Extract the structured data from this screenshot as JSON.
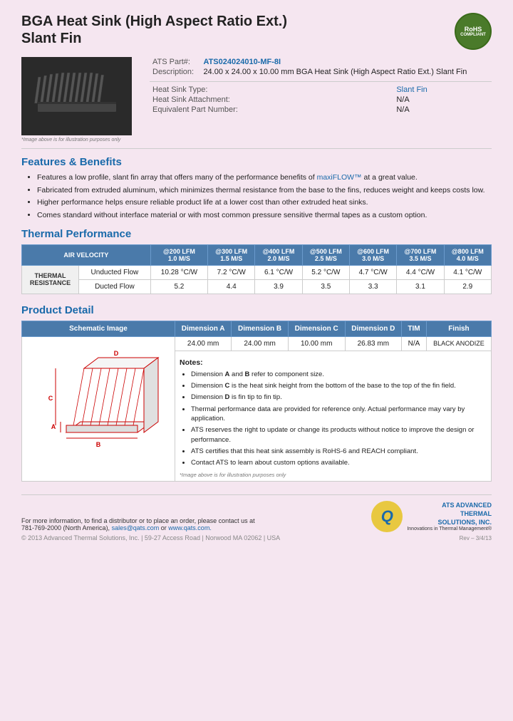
{
  "page": {
    "title_line1": "BGA Heat Sink (High Aspect Ratio Ext.)",
    "title_line2": "Slant Fin",
    "rohs": {
      "line1": "RoHS",
      "line2": "COMPLIANT"
    },
    "part_label": "ATS Part#:",
    "part_number": "ATS024024010-MF-8I",
    "description_label": "Description:",
    "description": "24.00 x 24.00 x 10.00 mm BGA Heat Sink (High Aspect Ratio Ext.) Slant Fin",
    "heat_sink_type_label": "Heat Sink Type:",
    "heat_sink_type": "Slant Fin",
    "heat_sink_attachment_label": "Heat Sink Attachment:",
    "heat_sink_attachment": "N/A",
    "equivalent_part_label": "Equivalent Part Number:",
    "equivalent_part": "N/A",
    "image_note": "*Image above is for illustration purposes only",
    "features_heading": "Features & Benefits",
    "features": [
      "Features a low profile, slant fin array that offers many of the performance benefits of maxiFLOW™ at a great value.",
      "Fabricated from extruded aluminum, which minimizes thermal resistance from the base to the fins, reduces weight and keeps costs low.",
      "Higher performance helps ensure reliable product life at a lower cost than other extruded heat sinks.",
      "Comes standard without interface material or with most common pressure sensitive thermal tapes as a custom option."
    ],
    "thermal_heading": "Thermal Performance",
    "thermal_table": {
      "header_col1": "AIR VELOCITY",
      "columns": [
        {
          "lfm": "@200 LFM",
          "ms": "1.0 M/S"
        },
        {
          "lfm": "@300 LFM",
          "ms": "1.5 M/S"
        },
        {
          "lfm": "@400 LFM",
          "ms": "2.0 M/S"
        },
        {
          "lfm": "@500 LFM",
          "ms": "2.5 M/S"
        },
        {
          "lfm": "@600 LFM",
          "ms": "3.0 M/S"
        },
        {
          "lfm": "@700 LFM",
          "ms": "3.5 M/S"
        },
        {
          "lfm": "@800 LFM",
          "ms": "4.0 M/S"
        }
      ],
      "row_label": "THERMAL RESISTANCE",
      "rows": [
        {
          "type": "Unducted Flow",
          "values": [
            "10.28 °C/W",
            "7.2 °C/W",
            "6.1 °C/W",
            "5.2 °C/W",
            "4.7 °C/W",
            "4.4 °C/W",
            "4.1 °C/W"
          ]
        },
        {
          "type": "Ducted Flow",
          "values": [
            "5.2",
            "4.4",
            "3.9",
            "3.5",
            "3.3",
            "3.1",
            "2.9"
          ]
        }
      ]
    },
    "product_detail_heading": "Product Detail",
    "detail_table": {
      "headers": [
        "Schematic Image",
        "Dimension A",
        "Dimension B",
        "Dimension C",
        "Dimension D",
        "TIM",
        "Finish"
      ],
      "values": [
        "24.00 mm",
        "24.00 mm",
        "10.00 mm",
        "26.83 mm",
        "N/A",
        "BLACK ANODIZE"
      ]
    },
    "notes_heading": "Notes:",
    "notes": [
      "Dimension A and B refer to component size.",
      "Dimension C is the heat sink height from the bottom of the base to the top of the fin field.",
      "Dimension D is fin tip to fin tip.",
      "Thermal performance data are provided for reference only. Actual performance may vary by application.",
      "ATS reserves the right to update or change its products without notice to improve the design or performance.",
      "ATS certifies that this heat sink assembly is RoHS-6 and REACH compliant.",
      "Contact ATS to learn about custom options available."
    ],
    "schematic_note": "*Image above is for illustration purposes only",
    "footer": {
      "contact_text": "For more information, to find a distributor or to place an order, please contact us at",
      "phone": "781-769-2000 (North America),",
      "email": "sales@qats.com",
      "or": "or",
      "website": "www.qats.com.",
      "copyright": "© 2013 Advanced Thermal Solutions, Inc.  |  59-27 Access Road  |  Norwood MA  02062  |  USA",
      "rev": "Rev – 3/4/13"
    }
  }
}
